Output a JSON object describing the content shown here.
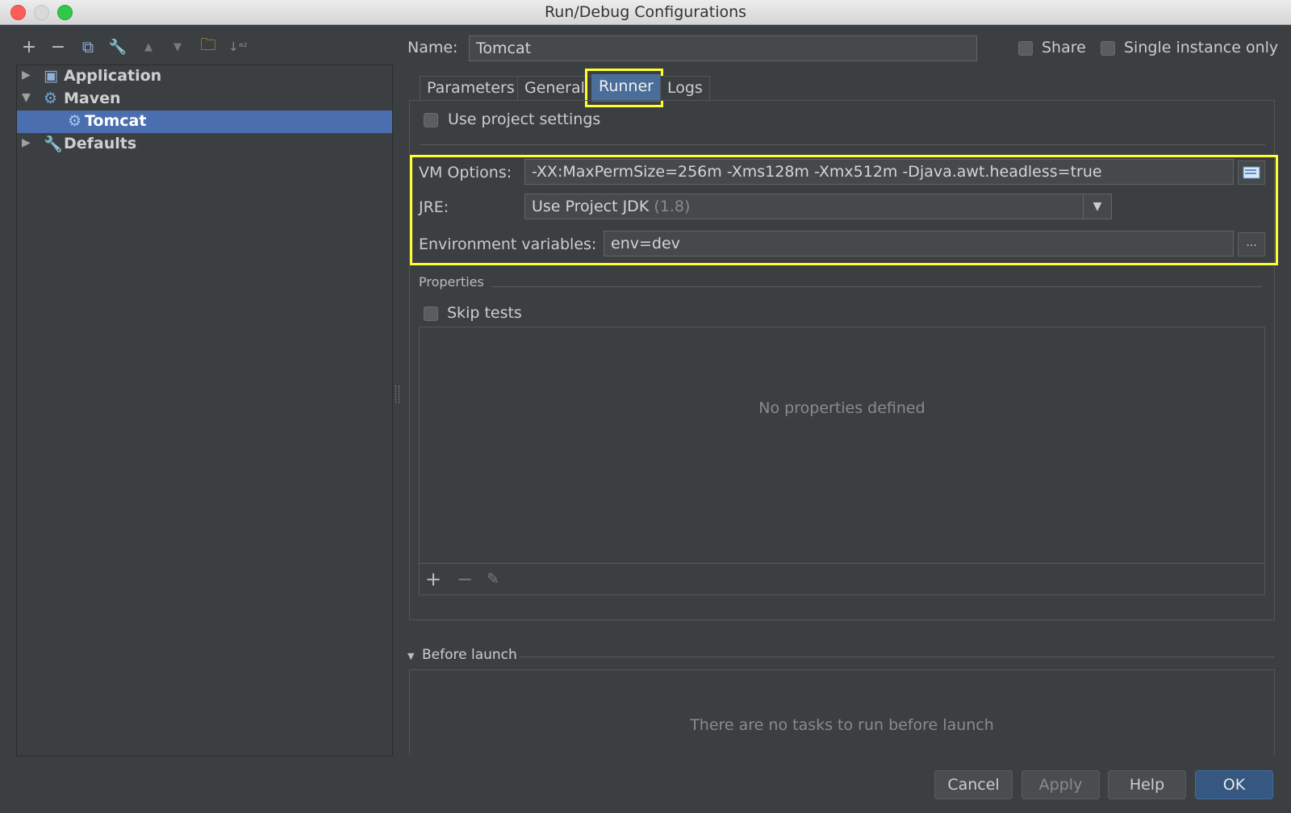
{
  "window": {
    "title": "Run/Debug Configurations"
  },
  "toolbar": {
    "add": "+",
    "remove": "−",
    "copy": "⧉",
    "edit": "🔧",
    "up": "▲",
    "down": "▼",
    "folder": "🗀",
    "sort": "↓ᵃᶻ"
  },
  "tree": {
    "items": [
      {
        "label": "Application",
        "expanded": false
      },
      {
        "label": "Maven",
        "expanded": true
      },
      {
        "label": "Tomcat",
        "selected": true
      },
      {
        "label": "Defaults",
        "expanded": false
      }
    ]
  },
  "header": {
    "name_label": "Name:",
    "name_value": "Tomcat",
    "share_label": "Share",
    "single_instance_label": "Single instance only"
  },
  "tabs": [
    "Parameters",
    "General",
    "Runner",
    "Logs"
  ],
  "active_tab": "Runner",
  "runner": {
    "use_project_settings": "Use project settings",
    "vm_options_label": "VM Options:",
    "vm_options_value": "-XX:MaxPermSize=256m -Xms128m -Xmx512m -Djava.awt.headless=true",
    "jre_label": "JRE:",
    "jre_value": "Use Project JDK",
    "jre_version": "(1.8)",
    "env_label": "Environment variables:",
    "env_value": "env=dev",
    "env_button": "...",
    "properties_label": "Properties",
    "skip_tests_label": "Skip tests",
    "no_properties": "No properties defined"
  },
  "before_launch": {
    "label": "Before launch",
    "empty": "There are no tasks to run before launch"
  },
  "buttons": {
    "cancel": "Cancel",
    "apply": "Apply",
    "help": "Help",
    "ok": "OK"
  },
  "colors": {
    "selection": "#4b6eaf",
    "highlight": "#ffff33",
    "ok_button": "#365880"
  }
}
